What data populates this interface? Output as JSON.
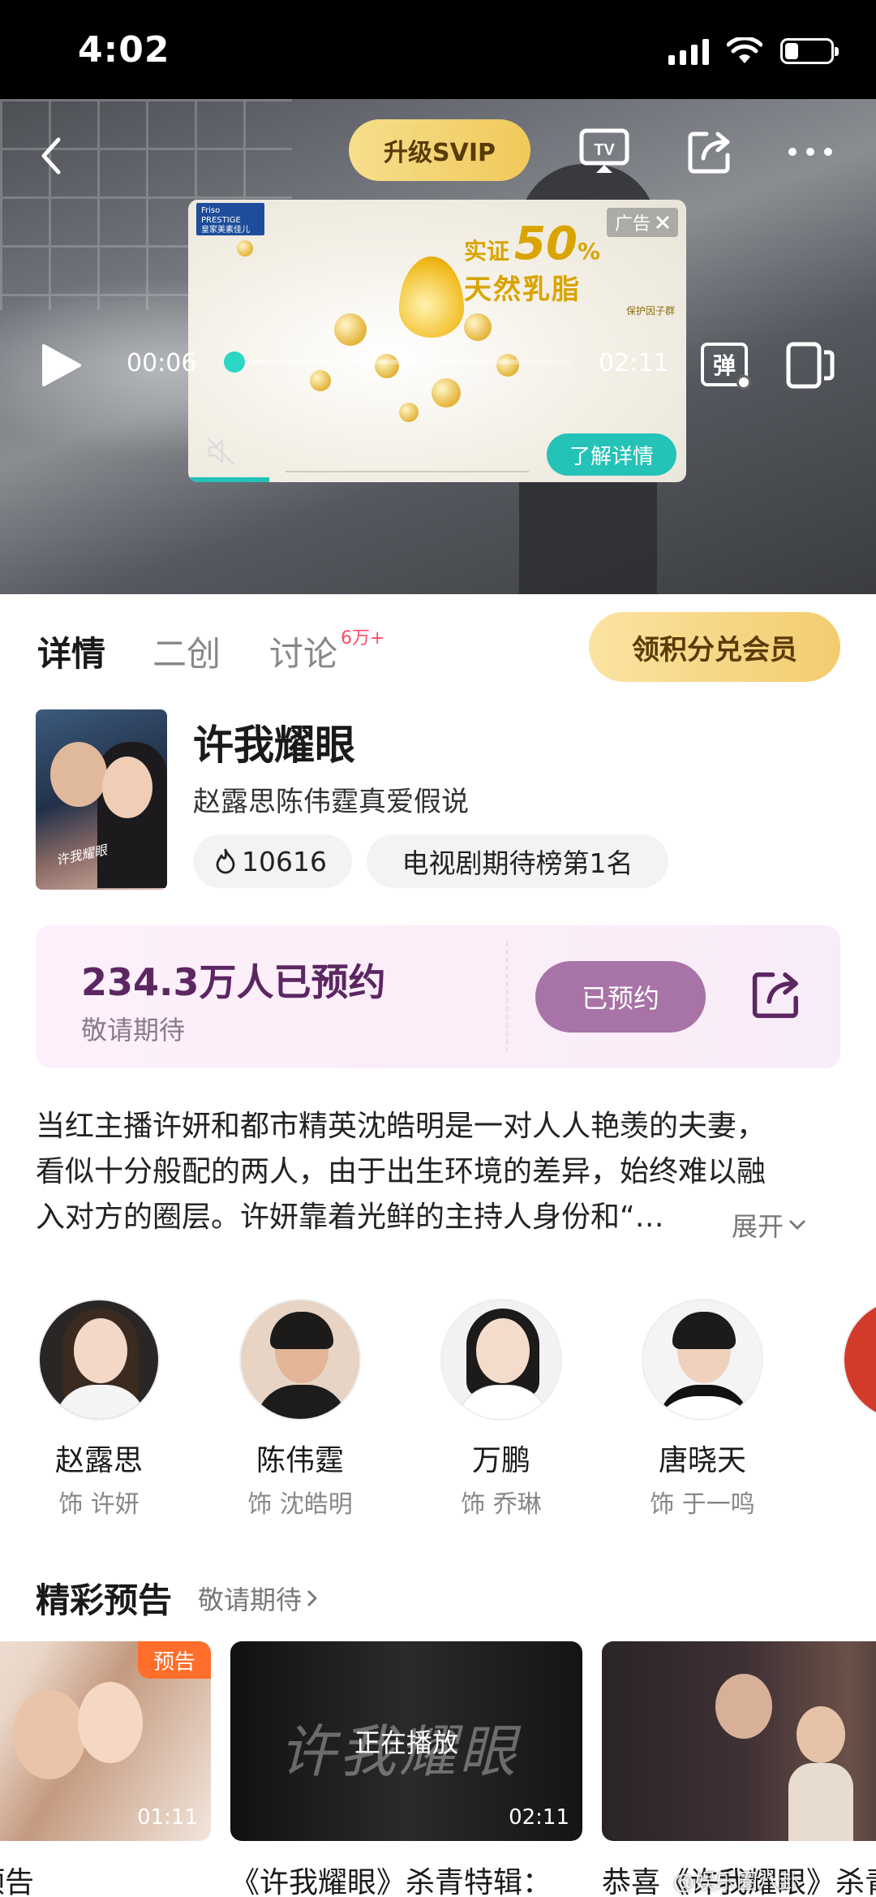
{
  "status_bar": {
    "time": "4:02"
  },
  "player": {
    "upgrade_label": "升级SVIP",
    "tv_icon": "tv-cast-icon",
    "current_time": "00:06",
    "duration": "02:11",
    "progress": 0.03,
    "danmu_label": "弹",
    "ad": {
      "badge": "广告",
      "brand_line1": "Friso PRESTIGE",
      "brand_line2": "皇家美素佳儿",
      "headline_prefix": "实证",
      "headline_number": "50",
      "headline_percent": "%",
      "headline_line2": "天然乳脂",
      "headline_sub": "保护因子群",
      "cta": "了解详情"
    }
  },
  "tabs": [
    {
      "label": "详情",
      "active": true
    },
    {
      "label": "二创",
      "active": false
    },
    {
      "label": "讨论",
      "active": false,
      "badge": "6万+"
    }
  ],
  "points_button": "领积分兑会员",
  "show": {
    "title": "许我耀眼",
    "subtitle": "赵露思陈伟霆真爱假说",
    "heat": "10616",
    "rank": "电视剧期待榜第1名",
    "poster_text": "许我耀眼"
  },
  "reservation": {
    "count": "234.3万人已预约",
    "hint": "敬请期待",
    "button": "已预约"
  },
  "synopsis": {
    "lines": [
      "当红主播许妍和都市精英沈皓明是一对人人艳羡的夫妻，",
      "看似十分般配的两人，由于出生环境的差异，始终难以融",
      "入对方的圈层。许妍靠着光鲜的主持人身份和“…"
    ],
    "expand": "展开"
  },
  "cast": [
    {
      "name": "赵露思",
      "role": "饰 许妍"
    },
    {
      "name": "陈伟霆",
      "role": "饰 沈皓明"
    },
    {
      "name": "万鹏",
      "role": "饰 乔琳"
    },
    {
      "name": "唐晓天",
      "role": "饰 于一鸣"
    }
  ],
  "trailers_section": {
    "title": "精彩预告",
    "more": "敬请期待",
    "items": [
      {
        "title": "眼》首发预告",
        "duration": "01:11",
        "tag": "预告"
      },
      {
        "title": "《许我耀眼》杀青特辑：",
        "duration": "02:11",
        "overlay": "正在播放",
        "script": "许我耀眼"
      },
      {
        "title": "恭喜《许我耀眼》杀青",
        "duration": ""
      }
    ]
  },
  "watermark": "@娱乐圈八卦"
}
